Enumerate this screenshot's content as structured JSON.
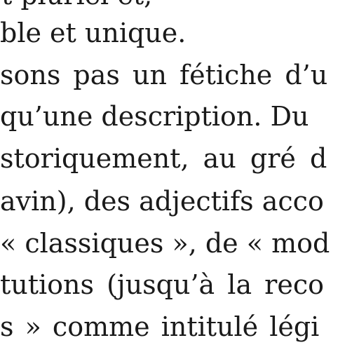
{
  "document": {
    "lines": [
      "t pluriel et, ",
      "ble et unique.",
      "sons pas un fétiche d’u",
      "qu’une description. Du",
      "storiquement, au gré d",
      "avin), des adjectifs acco",
      "« classiques », de « mod",
      "tutions (jusqu’à la reco",
      "s » comme intitulé légi"
    ]
  }
}
